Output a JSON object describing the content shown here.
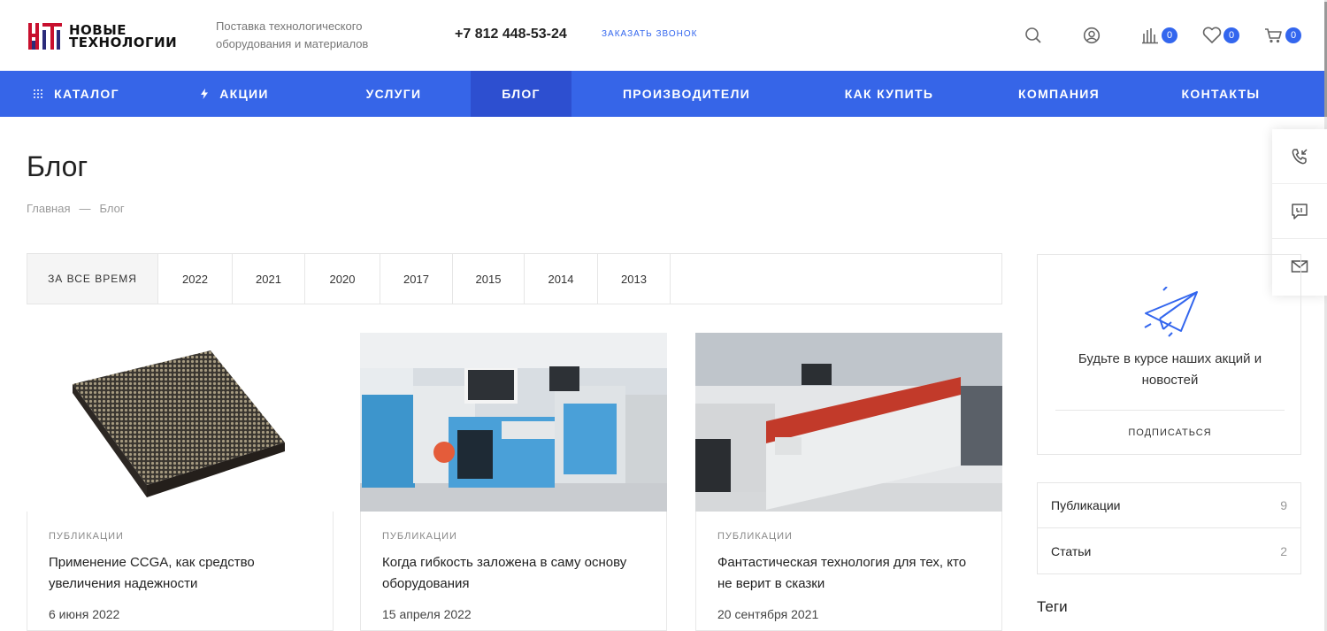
{
  "header": {
    "logo_line1": "НОВЫЕ",
    "logo_line2": "ТЕХНОЛОГИИ",
    "tagline": "Поставка технологического оборудования и материалов",
    "phone": "+7 812 448-53-24",
    "callback": "ЗАКАЗАТЬ ЗВОНОК",
    "icons": [
      "search-icon",
      "user-icon",
      "compare-icon",
      "heart-icon",
      "cart-icon"
    ],
    "compare_count": "0",
    "favorites_count": "0",
    "cart_count": "0"
  },
  "nav": {
    "items": [
      {
        "label": "КАТАЛОГ",
        "icon": "grid-icon"
      },
      {
        "label": "АКЦИИ",
        "icon": "lightning-icon"
      },
      {
        "label": "УСЛУГИ"
      },
      {
        "label": "БЛОГ",
        "active": true
      },
      {
        "label": "ПРОИЗВОДИТЕЛИ"
      },
      {
        "label": "КАК КУПИТЬ"
      },
      {
        "label": "КОМПАНИЯ"
      },
      {
        "label": "КОНТАКТЫ"
      }
    ]
  },
  "page": {
    "title": "Блог",
    "breadcrumb": [
      "Главная",
      "—",
      "Блог"
    ]
  },
  "filter": {
    "items": [
      "ЗА ВСЕ ВРЕМЯ",
      "2022",
      "2021",
      "2020",
      "2017",
      "2015",
      "2014",
      "2013"
    ],
    "active": "ЗА ВСЕ ВРЕМЯ"
  },
  "posts": [
    {
      "category": "ПУБЛИКАЦИИ",
      "title": "Применение CCGA, как средство увеличения надежности",
      "date": "6 июня 2022"
    },
    {
      "category": "ПУБЛИКАЦИИ",
      "title": "Когда гибкость заложена в саму основу оборудования",
      "date": "15 апреля 2022"
    },
    {
      "category": "ПУБЛИКАЦИИ",
      "title": "Фантастическая технология для тех, кто не верит в сказки",
      "date": "20 сентября 2021"
    }
  ],
  "sidebar": {
    "subscribe_text": "Будьте в курсе наших акций и новостей",
    "subscribe_button": "ПОДПИСАТЬСЯ",
    "categories": [
      {
        "name": "Публикации",
        "count": "9"
      },
      {
        "name": "Статьи",
        "count": "2"
      }
    ],
    "tags_title": "Теги"
  },
  "floating": {
    "icons": [
      "phone-callback-icon",
      "chat-icon",
      "mail-icon"
    ]
  },
  "colors": {
    "accent": "#3665e8",
    "accent_active": "#2d4fd0",
    "text": "#333333"
  }
}
